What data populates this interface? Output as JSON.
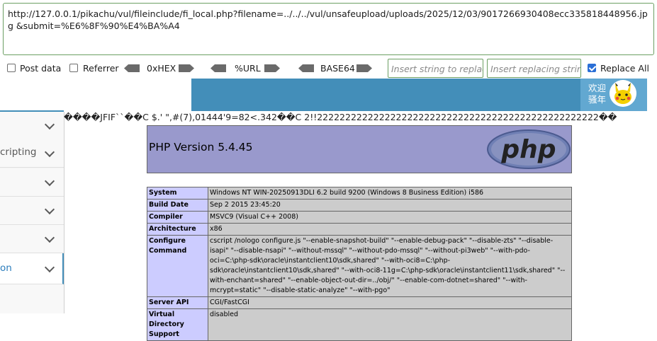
{
  "hackbar": {
    "url_value": "http://127.0.0.1/pikachu/vul/fileinclude/fi_local.php?filename=../../../vul/unsafeupload/uploads/2025/12/03/9017266930408ecc335818448956.jpg &submit=%E6%8F%90%E4%BA%A4",
    "post_data_label": "Post data",
    "referrer_label": "Referrer",
    "hex_label": "0xHEX",
    "url_label": "%URL",
    "base64_label": "BASE64",
    "insert_string_placeholder": "Insert string to replace",
    "insert_replacing_placeholder": "Insert replacing string",
    "replace_all_label": "Replace All",
    "post_data_checked": false,
    "referrer_checked": false,
    "replace_all_checked": true,
    "accent_color": "#6c9f63"
  },
  "header": {
    "user_line1": "欢迎",
    "user_line2": "骚年",
    "bar_color": "#438eb9"
  },
  "sidebar": {
    "items": [
      {
        "label": "",
        "active": false
      },
      {
        "label": "cripting",
        "active": false
      },
      {
        "label": "",
        "active": false
      },
      {
        "label": "",
        "active": false
      },
      {
        "label": "",
        "active": false
      },
      {
        "label": "on",
        "active": true
      },
      {
        "label": "",
        "active": false
      }
    ]
  },
  "content": {
    "garbage_text": "����JFIF``��C    $.' \",#(7),01444'9=82<.342��C   2!!22222222222222222222222222222222222222222222222222��",
    "php_version_title": "PHP Version 5.4.45",
    "php_logo_text": "php",
    "rows": [
      {
        "key": "System",
        "value": "Windows NT WIN-20250913DLI 6.2 build 9200 (Windows 8 Business Edition) i586"
      },
      {
        "key": "Build Date",
        "value": "Sep 2 2015 23:45:20"
      },
      {
        "key": "Compiler",
        "value": "MSVC9 (Visual C++ 2008)"
      },
      {
        "key": "Architecture",
        "value": "x86"
      },
      {
        "key": "Configure Command",
        "value": "cscript /nologo configure.js \"--enable-snapshot-build\" \"--enable-debug-pack\" \"--disable-zts\" \"--disable-isapi\" \"--disable-nsapi\" \"--without-mssql\" \"--without-pdo-mssql\" \"--without-pi3web\" \"--with-pdo-oci=C:\\php-sdk\\oracle\\instantclient10\\sdk,shared\" \"--with-oci8=C:\\php-sdk\\oracle\\instantclient10\\sdk,shared\" \"--with-oci8-11g=C:\\php-sdk\\oracle\\instantclient11\\sdk,shared\" \"--with-enchant=shared\" \"--enable-object-out-dir=../obj/\" \"--enable-com-dotnet=shared\" \"--with-mcrypt=static\" \"--disable-static-analyze\" \"--with-pgo\""
      },
      {
        "key": "Server API",
        "value": "CGI/FastCGI"
      },
      {
        "key": "Virtual Directory Support",
        "value": "disabled"
      }
    ]
  }
}
